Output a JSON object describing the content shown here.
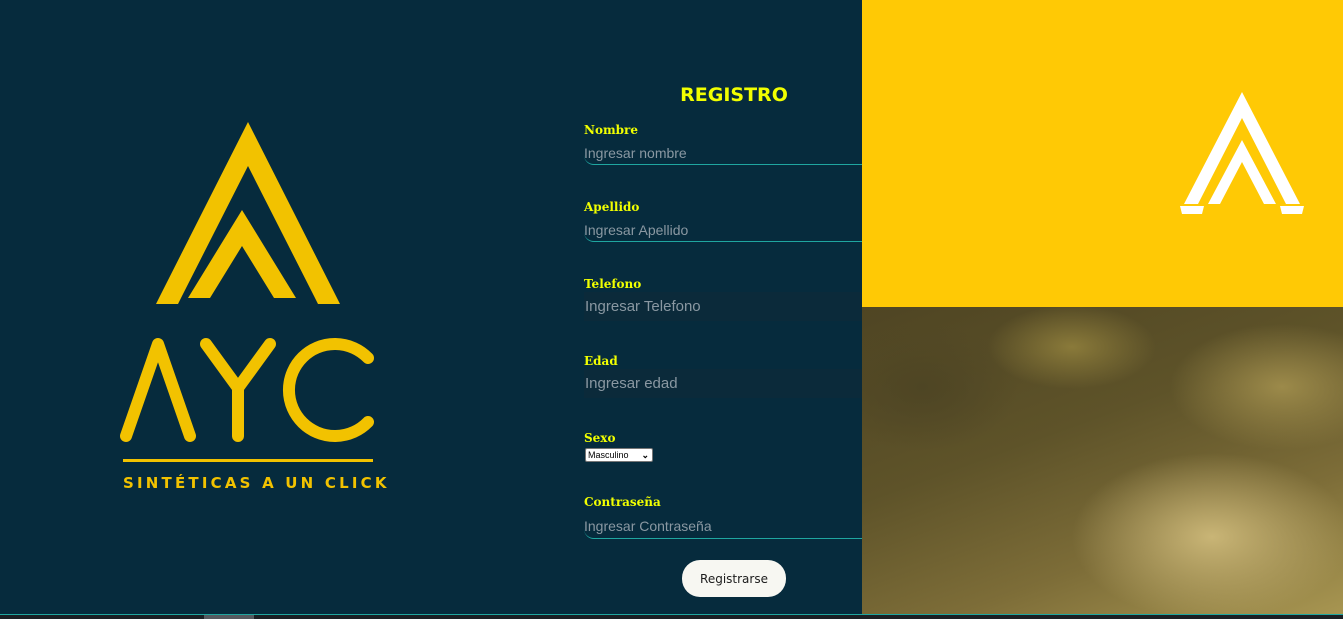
{
  "brand": {
    "logo_text": "AYC",
    "tagline": "SINTÉTICAS A UN CLICK",
    "logo_icon": "double-chevron-up-icon"
  },
  "form": {
    "title": "REGISTRO",
    "fields": {
      "nombre": {
        "label": "Nombre",
        "placeholder": "Ingresar nombre"
      },
      "apellido": {
        "label": "Apellido",
        "placeholder": "Ingresar Apellido"
      },
      "telefono": {
        "label": "Telefono",
        "placeholder": "Ingresar Telefono"
      },
      "edad": {
        "label": "Edad",
        "placeholder": "Ingresar edad"
      },
      "sexo": {
        "label": "Sexo",
        "selected": "Masculino"
      },
      "contrasena": {
        "label": "Contraseña",
        "placeholder": "Ingresar Contraseña"
      }
    },
    "submit_label": "Registrarse"
  },
  "colors": {
    "background": "#062b3d",
    "accent_yellow": "#ffc905",
    "label_yellow": "#f1ff00",
    "input_underline": "#1fa6a0"
  }
}
